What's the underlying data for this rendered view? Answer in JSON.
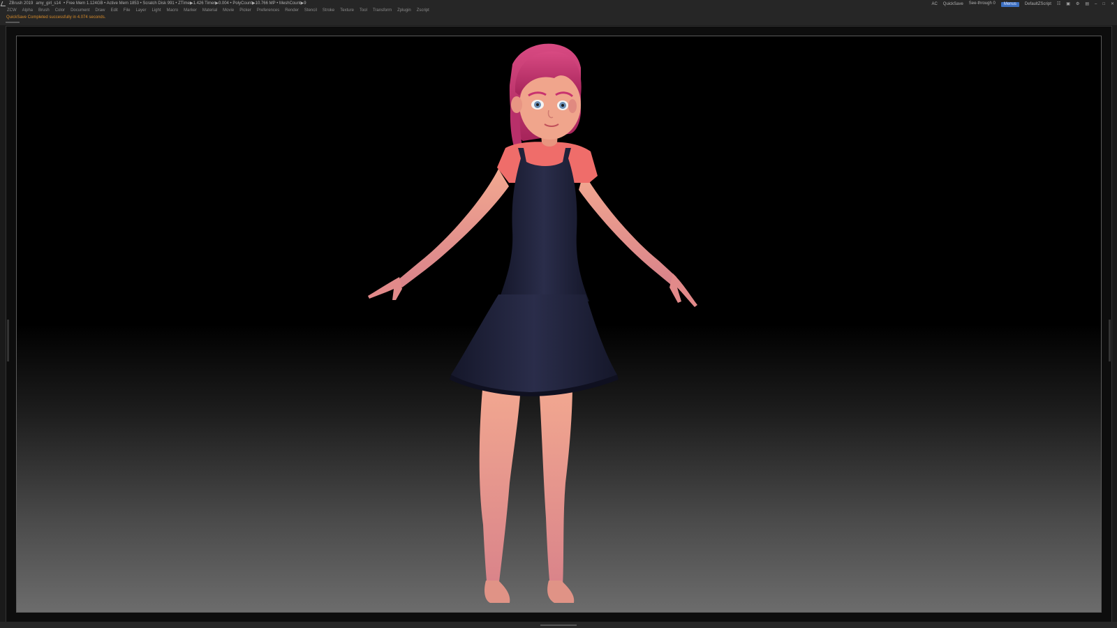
{
  "titlebar": {
    "app_name": "ZBrush 2019",
    "file_name": "amy_girl_s14",
    "stats": "• Free Mem 1.124GB • Active Mem 1853 • Scratch Disk 991 • ZTime▶1.426 Timer▶0.004 • PolyCount▶10.766 MP • MeshCount▶9",
    "ac_label": "AC",
    "quicksave_label": "QuickSave",
    "see_through_label": "See-through",
    "see_through_value": "0",
    "see_through_fraction": 0.0,
    "menus_label": "Menus",
    "script_label": "DefaultZScript"
  },
  "menubar": {
    "items": [
      "ZCW",
      "Alpha",
      "Brush",
      "Color",
      "Document",
      "Draw",
      "Edit",
      "File",
      "Layer",
      "Light",
      "Macro",
      "Marker",
      "Material",
      "Movie",
      "Picker",
      "Preferences",
      "Render",
      "Stencil",
      "Stroke",
      "Texture",
      "Tool",
      "Transform",
      "Zplugin",
      "Zscript"
    ]
  },
  "notification": {
    "text": "QuickSave Completed successfully in 4.074 seconds."
  },
  "colors": {
    "skin": "#e79a8a",
    "hair": "#c8326e",
    "dress": "#1d1f33",
    "shirt": "#ef6d6a",
    "note": "#d98c2a",
    "menu_button": "#3c6fc0"
  }
}
